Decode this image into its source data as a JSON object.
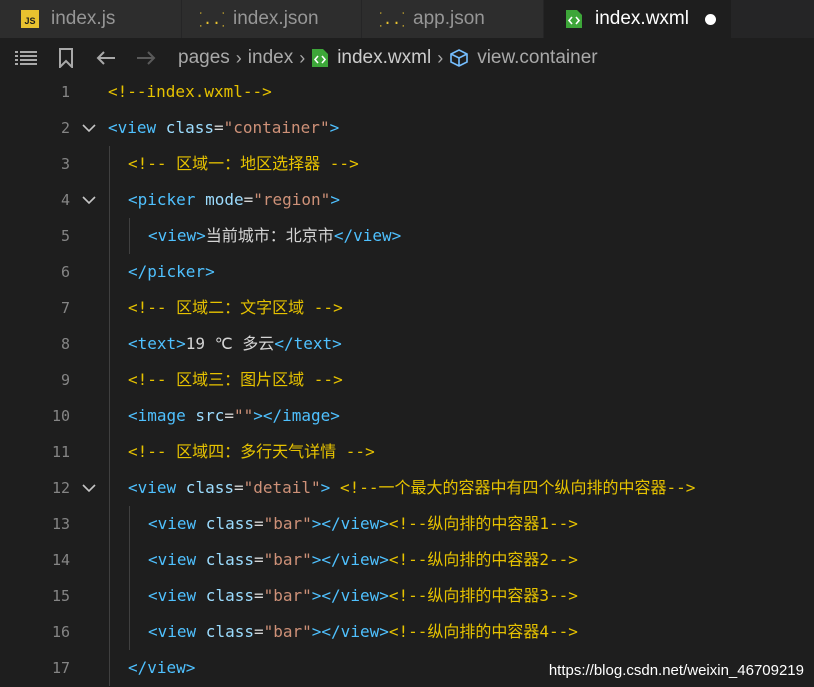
{
  "tabs": [
    {
      "label": "index.js",
      "icon": "js-file-icon",
      "active": false
    },
    {
      "label": "index.json",
      "icon": "json-file-icon",
      "active": false
    },
    {
      "label": "app.json",
      "icon": "json-file-icon",
      "active": false
    },
    {
      "label": "index.wxml",
      "icon": "wxml-file-icon",
      "active": true,
      "modified": true
    }
  ],
  "breadcrumb": {
    "items": [
      "pages",
      "index",
      "index.wxml",
      "view.container"
    ]
  },
  "editor": {
    "lines": [
      {
        "num": "1",
        "tokens": [
          [
            "c",
            "<!--index.wxml-->"
          ]
        ]
      },
      {
        "num": "2",
        "tokens": [
          [
            "t",
            "<view"
          ],
          [
            "a",
            " class"
          ],
          [
            "e",
            "="
          ],
          [
            "s",
            "\"container\""
          ],
          [
            "t",
            ">"
          ]
        ]
      },
      {
        "num": "3",
        "tokens": [
          [
            "c",
            "<!-- 区域一：地区选择器 -->"
          ]
        ]
      },
      {
        "num": "4",
        "tokens": [
          [
            "t",
            "<picker"
          ],
          [
            "a",
            " mode"
          ],
          [
            "e",
            "="
          ],
          [
            "s",
            "\"region\""
          ],
          [
            "t",
            ">"
          ]
        ]
      },
      {
        "num": "5",
        "tokens": [
          [
            "t",
            "<view>"
          ],
          [
            "x",
            "当前城市：北京市"
          ],
          [
            "t",
            "</view>"
          ]
        ]
      },
      {
        "num": "6",
        "tokens": [
          [
            "t",
            "</picker>"
          ]
        ]
      },
      {
        "num": "7",
        "tokens": [
          [
            "c",
            "<!-- 区域二：文字区域 -->"
          ]
        ]
      },
      {
        "num": "8",
        "tokens": [
          [
            "t",
            "<text>"
          ],
          [
            "x",
            "19 ℃ 多云"
          ],
          [
            "t",
            "</text>"
          ]
        ]
      },
      {
        "num": "9",
        "tokens": [
          [
            "c",
            "<!-- 区域三：图片区域 -->"
          ]
        ]
      },
      {
        "num": "10",
        "tokens": [
          [
            "t",
            "<image"
          ],
          [
            "a",
            " src"
          ],
          [
            "e",
            "="
          ],
          [
            "s",
            "\"\""
          ],
          [
            "t",
            "></image>"
          ]
        ]
      },
      {
        "num": "11",
        "tokens": [
          [
            "c",
            "<!-- 区域四：多行天气详情 -->"
          ]
        ]
      },
      {
        "num": "12",
        "tokens": [
          [
            "t",
            "<view"
          ],
          [
            "a",
            " class"
          ],
          [
            "e",
            "="
          ],
          [
            "s",
            "\"detail\""
          ],
          [
            "t",
            ">"
          ],
          [
            "x",
            " "
          ],
          [
            "c",
            "<!--一个最大的容器中有四个纵向排的中容器-->"
          ]
        ]
      },
      {
        "num": "13",
        "tokens": [
          [
            "t",
            "<view"
          ],
          [
            "a",
            " class"
          ],
          [
            "e",
            "="
          ],
          [
            "s",
            "\"bar\""
          ],
          [
            "t",
            "></view>"
          ],
          [
            "c",
            "<!--纵向排的中容器1-->"
          ]
        ]
      },
      {
        "num": "14",
        "tokens": [
          [
            "t",
            "<view"
          ],
          [
            "a",
            " class"
          ],
          [
            "e",
            "="
          ],
          [
            "s",
            "\"bar\""
          ],
          [
            "t",
            "></view>"
          ],
          [
            "c",
            "<!--纵向排的中容器2-->"
          ]
        ]
      },
      {
        "num": "15",
        "tokens": [
          [
            "t",
            "<view"
          ],
          [
            "a",
            " class"
          ],
          [
            "e",
            "="
          ],
          [
            "s",
            "\"bar\""
          ],
          [
            "t",
            "></view>"
          ],
          [
            "c",
            "<!--纵向排的中容器3-->"
          ]
        ]
      },
      {
        "num": "16",
        "tokens": [
          [
            "t",
            "<view"
          ],
          [
            "a",
            " class"
          ],
          [
            "e",
            "="
          ],
          [
            "s",
            "\"bar\""
          ],
          [
            "t",
            "></view>"
          ],
          [
            "c",
            "<!--纵向排的中容器4-->"
          ]
        ]
      },
      {
        "num": "17",
        "tokens": [
          [
            "t",
            "</view>"
          ]
        ]
      }
    ]
  },
  "watermark": "https://blog.csdn.net/weixin_46709219",
  "colors": {
    "comment": "#e6c200",
    "tag": "#4fc1ff",
    "attr": "#9cdcfe",
    "string": "#ce9178",
    "background": "#1e1e1e",
    "jsIcon": "#e8c22f",
    "jsonIcon": "#e8c22f",
    "wxmlIcon": "#3da639"
  }
}
